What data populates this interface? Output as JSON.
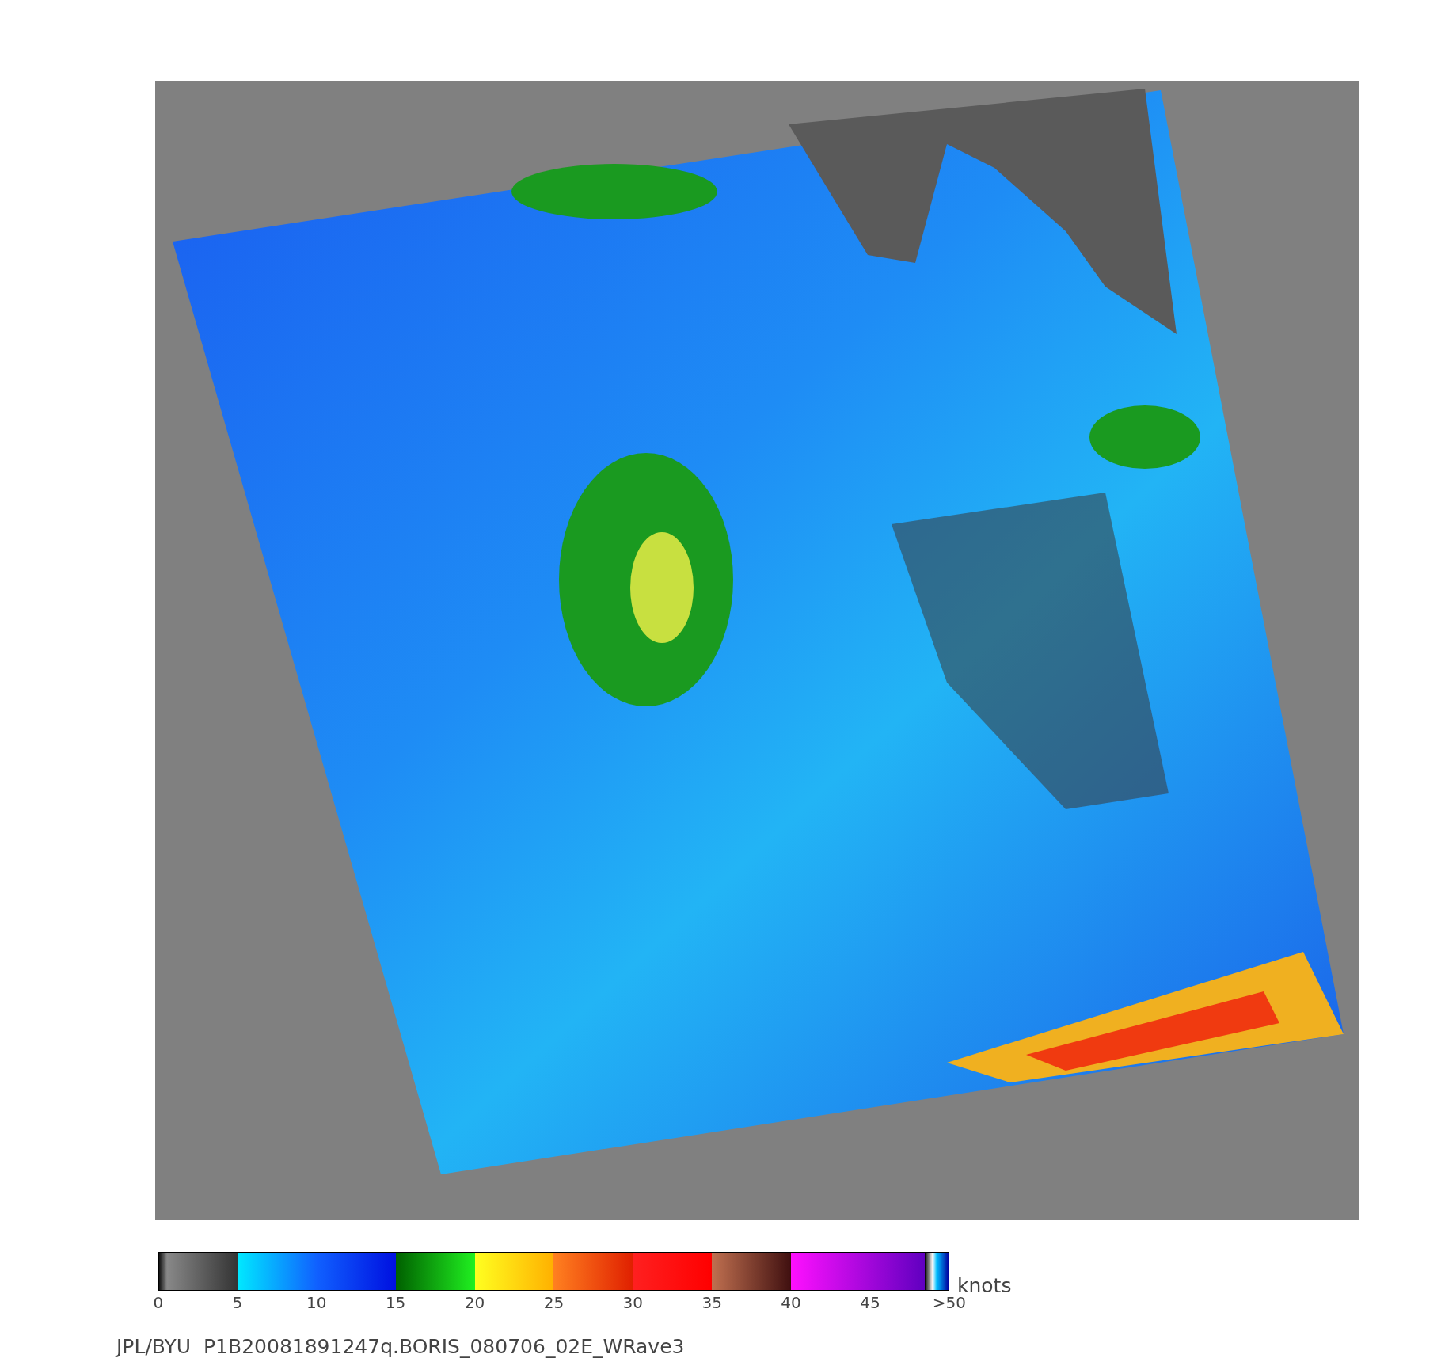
{
  "colorbar": {
    "ticks": [
      "0",
      "5",
      "10",
      "15",
      "20",
      "25",
      "30",
      "35",
      "40",
      "45",
      ">50"
    ],
    "unit": "knots"
  },
  "caption": "JPL/BYU  P1B20081891247q.BORIS_080706_02E_WRave3"
}
